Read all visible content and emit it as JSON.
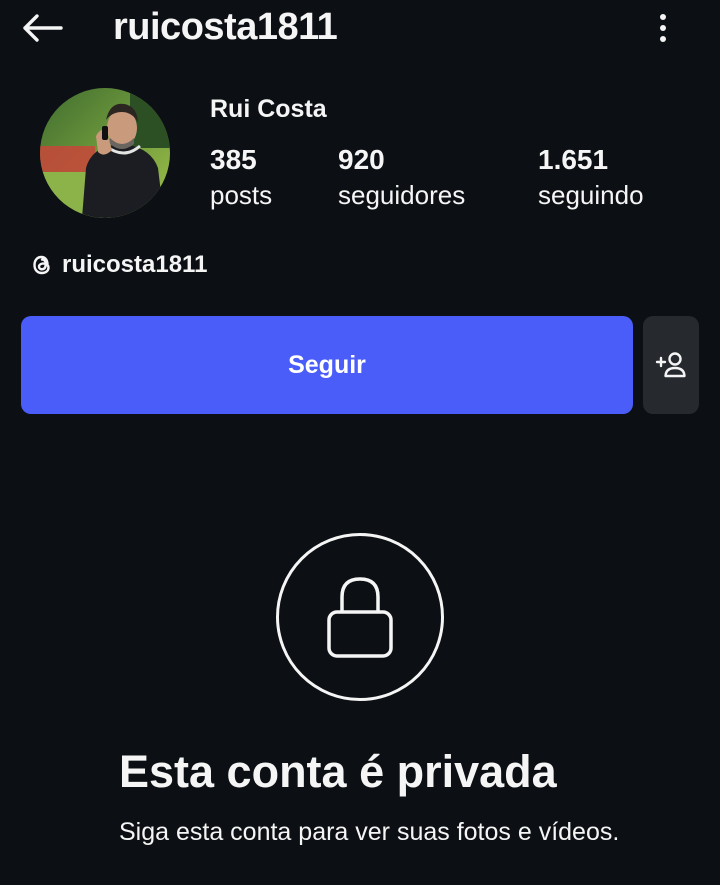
{
  "header": {
    "username": "ruicosta1811",
    "back_icon": "arrow-left-icon",
    "more_icon": "more-vertical-icon"
  },
  "profile": {
    "full_name": "Rui Costa",
    "stats": {
      "posts": {
        "value": "385",
        "label": "posts"
      },
      "followers": {
        "value": "920",
        "label": "seguidores"
      },
      "following": {
        "value": "1.651",
        "label": "seguindo"
      }
    },
    "threads": {
      "icon": "threads-icon",
      "handle": "ruicosta1811"
    }
  },
  "actions": {
    "follow_label": "Seguir",
    "suggest_icon": "add-person-icon"
  },
  "private_notice": {
    "icon": "lock-icon",
    "title": "Esta conta é privada",
    "subtitle": "Siga esta conta para ver suas fotos e vídeos."
  },
  "colors": {
    "background": "#0c1014",
    "accent": "#4a5df9",
    "secondary_button": "#26292e",
    "text": "#f5f5f5"
  }
}
